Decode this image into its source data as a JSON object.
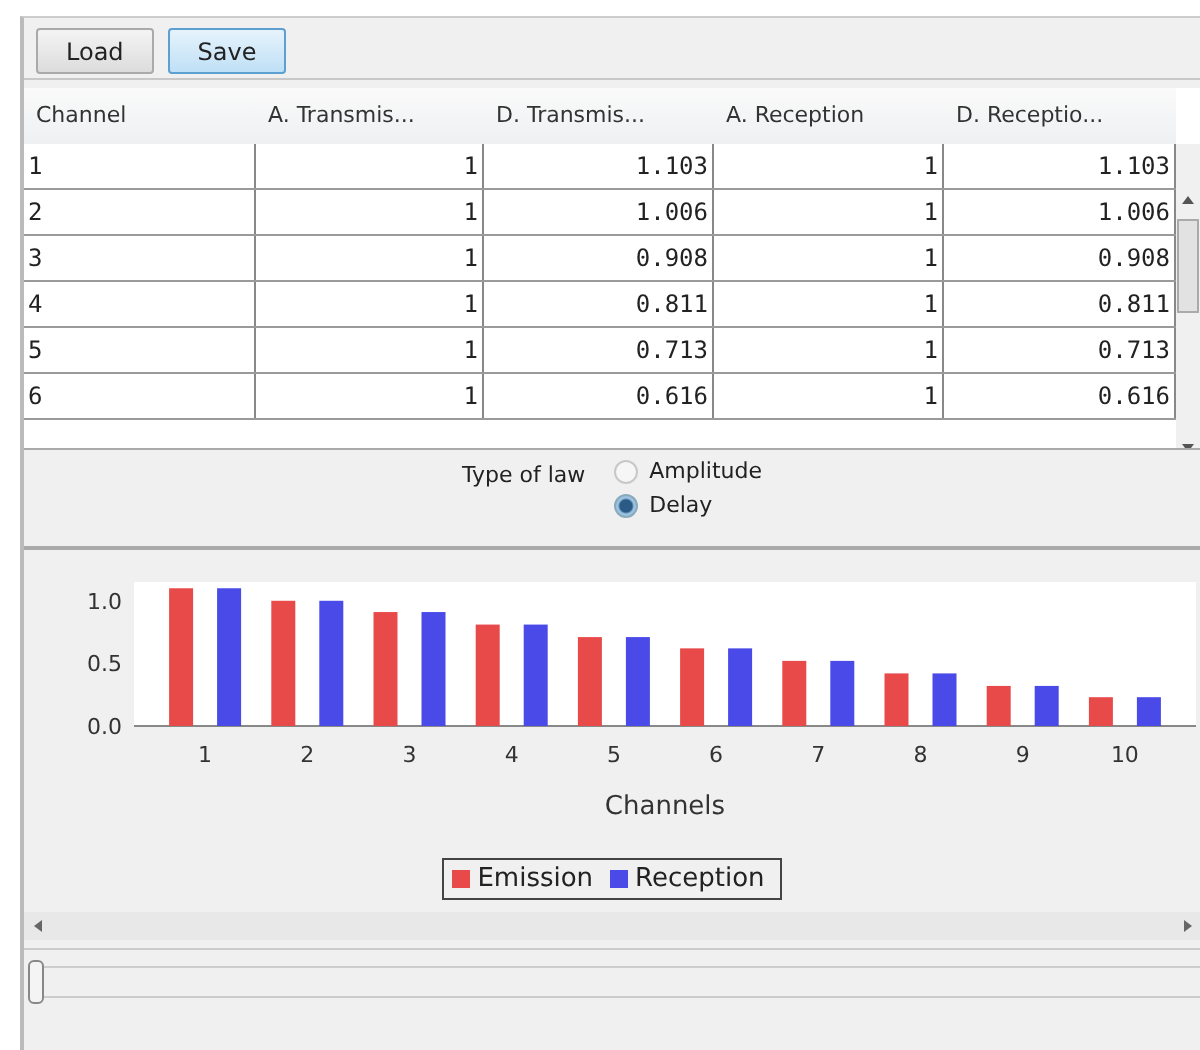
{
  "toolbar": {
    "buttons": [
      {
        "label": "Load",
        "highlighted": false
      },
      {
        "label": "Save",
        "highlighted": true
      }
    ]
  },
  "table": {
    "columns": [
      "Channel",
      "A. Transmis...",
      "D. Transmis...",
      "A. Reception",
      "D. Receptio..."
    ],
    "rows": [
      [
        "1",
        "1",
        "1.103",
        "1",
        "1.103"
      ],
      [
        "2",
        "1",
        "1.006",
        "1",
        "1.006"
      ],
      [
        "3",
        "1",
        "0.908",
        "1",
        "0.908"
      ],
      [
        "4",
        "1",
        "0.811",
        "1",
        "0.811"
      ],
      [
        "5",
        "1",
        "0.713",
        "1",
        "0.713"
      ],
      [
        "6",
        "1",
        "0.616",
        "1",
        "0.616"
      ]
    ]
  },
  "law": {
    "label": "Type of law",
    "options": [
      {
        "label": "Amplitude",
        "selected": false
      },
      {
        "label": "Delay",
        "selected": true
      }
    ]
  },
  "chart": {
    "chart_data": {
      "type": "bar",
      "xlabel": "Channels",
      "categories": [
        "1",
        "2",
        "3",
        "4",
        "5",
        "6",
        "7",
        "8",
        "9",
        "10"
      ],
      "series": [
        {
          "name": "Emission",
          "color": "#e84a4a",
          "values": [
            1.1,
            1.0,
            0.91,
            0.81,
            0.71,
            0.62,
            0.52,
            0.42,
            0.32,
            0.23
          ]
        },
        {
          "name": "Reception",
          "color": "#4a4ae8",
          "values": [
            1.1,
            1.0,
            0.91,
            0.81,
            0.71,
            0.62,
            0.52,
            0.42,
            0.32,
            0.23
          ]
        }
      ],
      "legend": true,
      "ylim": [
        0,
        1.15
      ],
      "yticks": [
        {
          "value": 0,
          "label": "0.0"
        },
        {
          "value": 0.5,
          "label": "0.5"
        },
        {
          "value": 1,
          "label": "1.0"
        }
      ]
    }
  },
  "slider": {
    "level": 0
  }
}
